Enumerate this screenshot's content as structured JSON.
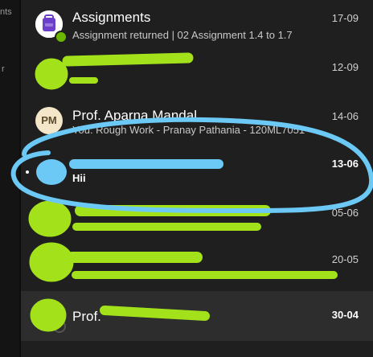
{
  "left_rail": {
    "text_a": "nts",
    "text_b": "r"
  },
  "chats": [
    {
      "title": "Assignments",
      "subtitle": "Assignment returned | 02 Assignment 1.4 to 1.7",
      "date": "17-09"
    },
    {
      "title": "",
      "subtitle": "",
      "date": "12-09"
    },
    {
      "title": "Prof. Aparna Mandal",
      "subtitle": "You: Rough Work - Pranay Pathania - 120ML7051",
      "date": "14-06",
      "avatar_initials": "PM"
    },
    {
      "title": "",
      "subtitle": "Hii",
      "date": "13-06",
      "unread": true
    },
    {
      "title": "",
      "subtitle": "",
      "date": "05-06"
    },
    {
      "title": "",
      "subtitle": "",
      "date": "20-05"
    },
    {
      "title": "Prof.",
      "subtitle": "",
      "date": "30-04",
      "selected": true
    }
  ],
  "colors": {
    "background": "#1f1f1f",
    "selected": "#2d2d2d",
    "redaction_green": "#a3e21a",
    "annotation_blue": "#6cc9f5",
    "assignments_purple": "#6b3fc9",
    "status_green": "#6bb700"
  },
  "icons": {
    "assignments": "backpack-icon",
    "status": "check-badge-icon"
  }
}
